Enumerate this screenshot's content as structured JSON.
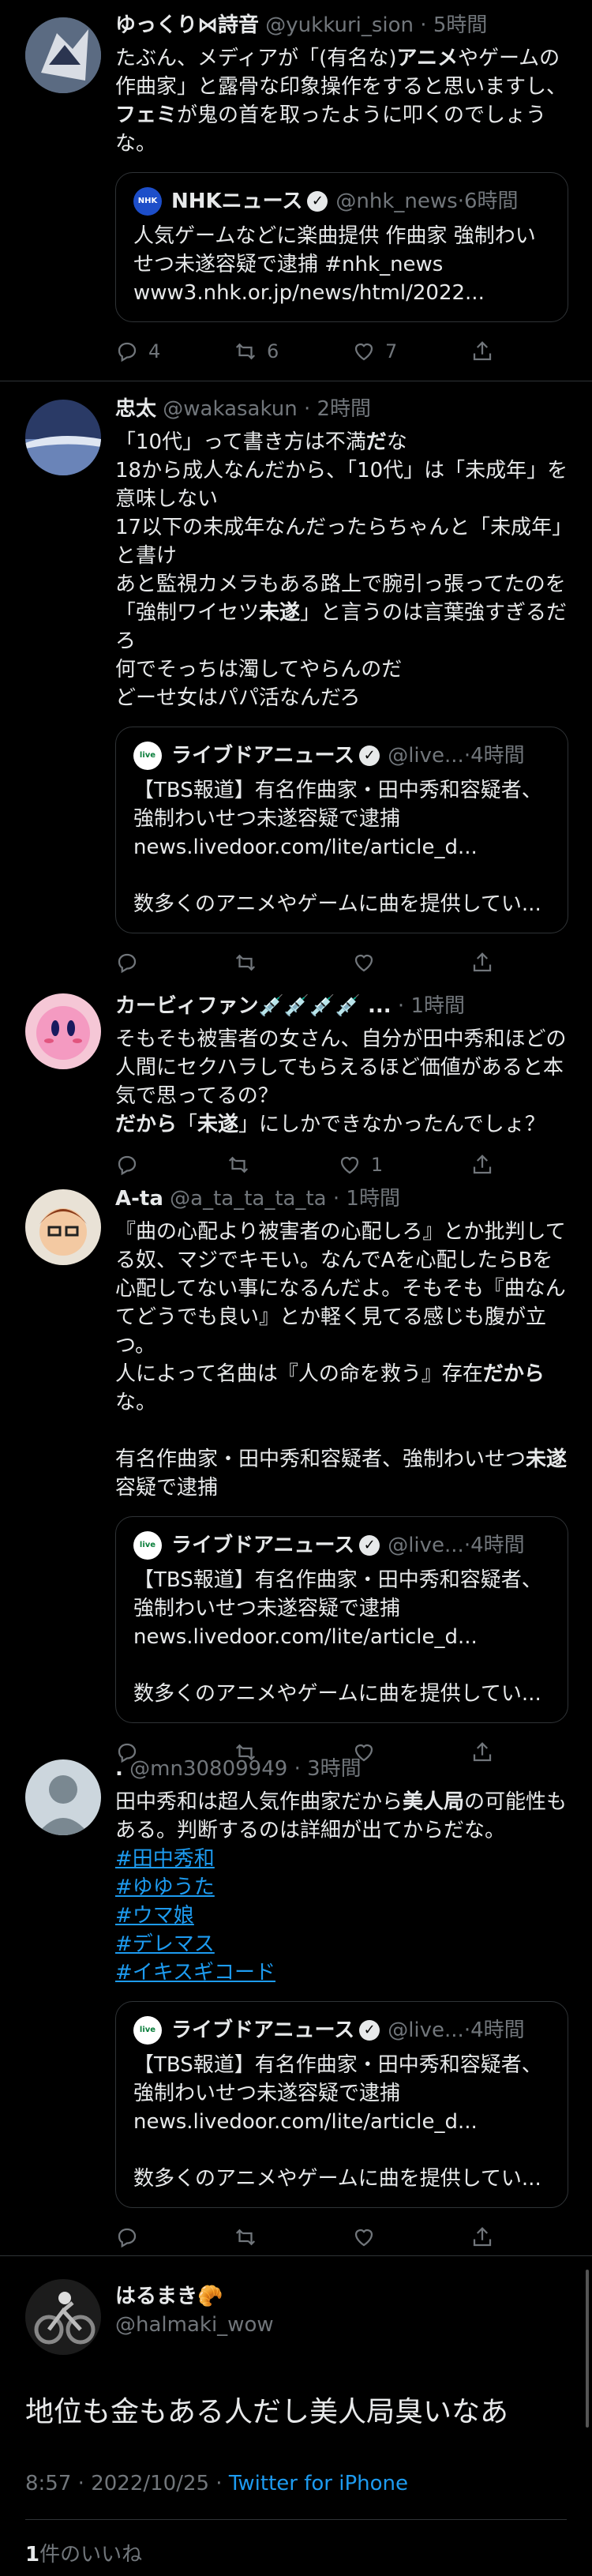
{
  "colors": {
    "accent": "#1d9bf0",
    "background": "#000000",
    "text": "#e7e9ea",
    "muted": "#71767b",
    "divider": "#2f3336"
  },
  "tweets": [
    {
      "name": "ゆっくり⋈詩音",
      "handle": "@yukkuri_sion",
      "time": "5時間",
      "body_html": "たぶん、メディアが「(有名な)<b>アニメ</b>やゲームの作曲家」と露骨な印象操作をすると思いますし、<b>フェミ</b>が鬼の首を取ったように叩くのでしょうな。",
      "quote": {
        "name": "NHKニュース",
        "handle": "@nhk_news",
        "time": "6時間",
        "lines": [
          "人気ゲームなどに楽曲提供 作曲家 強制わいせつ未遂容疑で逮捕 #nhk_news",
          "www3.nhk.or.jp/news/html/2022..."
        ]
      },
      "replies": "4",
      "retweets": "6",
      "likes": "7"
    },
    {
      "name": "忠太",
      "handle": "@wakasakun",
      "time": "2時間",
      "body_html": "「10代」って書き方は不満<b>だ</b>な<br>18から成人なんだから、「10代」は「未成年」を意味しない<br>17以下の未成年なんだったらちゃんと「未成年」と書け<br>あと監視カメラもある路上で腕引っ張ってたのを「強制ワイセツ<b>未遂</b>」と言うのは言葉強すぎるだろ<br>何でそっちは濁してやらんのだ<br>どーせ女はパパ活なんだろ",
      "quote": {
        "name": "ライブドアニュース",
        "handle": "@live...",
        "time": "4時間",
        "lines": [
          "【TBS報道】有名作曲家・田中秀和容疑者、強制わいせつ未遂容疑で逮捕",
          "news.livedoor.com/lite/article_d...",
          "",
          "数多くのアニメやゲームに曲を提供してい..."
        ]
      },
      "replies": "",
      "retweets": "",
      "likes": ""
    },
    {
      "name": "カービィファン💉💉💉💉 ...",
      "handle": "",
      "time": "1時間",
      "body_html": "そもそも被害者の女さん、自分が田中秀和ほどの人間にセクハラしてもらえるほど価値があると本気で思ってるの？<br><b>だから</b>「<b>未遂</b>」にしかできなかったんでしょ？",
      "quote": null,
      "replies": "",
      "retweets": "",
      "likes": "1"
    },
    {
      "name": "A-ta",
      "handle": "@a_ta_ta_ta_ta",
      "time": "1時間",
      "body_html": "『曲の心配より被害者の心配しろ』とか批判してる奴、マジでキモい。なんでAを心配したらBを心配してない事になるんだよ。そもそも『曲なんてどうでも良い』とか軽く見てる感じも腹が立つ。<br>人によって名曲は『人の命を救う』存在<b>だから</b>な。<br><br>有名作曲家・田中秀和容疑者、強制わいせつ<b>未遂</b>容疑で逮捕",
      "quote": {
        "name": "ライブドアニュース",
        "handle": "@live...",
        "time": "4時間",
        "lines": [
          "【TBS報道】有名作曲家・田中秀和容疑者、強制わいせつ未遂容疑で逮捕",
          "news.livedoor.com/lite/article_d...",
          "",
          "数多くのアニメやゲームに曲を提供してい..."
        ]
      },
      "replies": "",
      "retweets": "",
      "likes": ""
    },
    {
      "name": ".",
      "handle": "@mn30809949",
      "time": "3時間",
      "body_html": "田中秀和は超人気作曲家だから<b>美人局</b>の可能性もある。判断するのは詳細が出てからだな。",
      "hashtags": [
        "#田中秀和",
        "#ゆゆうた",
        "#ウマ娘",
        "#デレマス",
        "#イキスギコード"
      ],
      "quote": {
        "name": "ライブドアニュース",
        "handle": "@live...",
        "time": "4時間",
        "lines": [
          "【TBS報道】有名作曲家・田中秀和容疑者、強制わいせつ未遂容疑で逮捕",
          "news.livedoor.com/lite/article_d...",
          "",
          "数多くのアニメやゲームに曲を提供してい..."
        ]
      },
      "replies": "",
      "retweets": "",
      "likes": ""
    }
  ],
  "main": {
    "name": "はるまき🥐",
    "handle": "@halmaki_wow",
    "text": "地位も金もある人だし美人局臭いなあ",
    "time": "8:57",
    "date": "2022/10/25",
    "source": "Twitter for iPhone",
    "likes_count": "1",
    "likes_label": "件のいいね"
  }
}
